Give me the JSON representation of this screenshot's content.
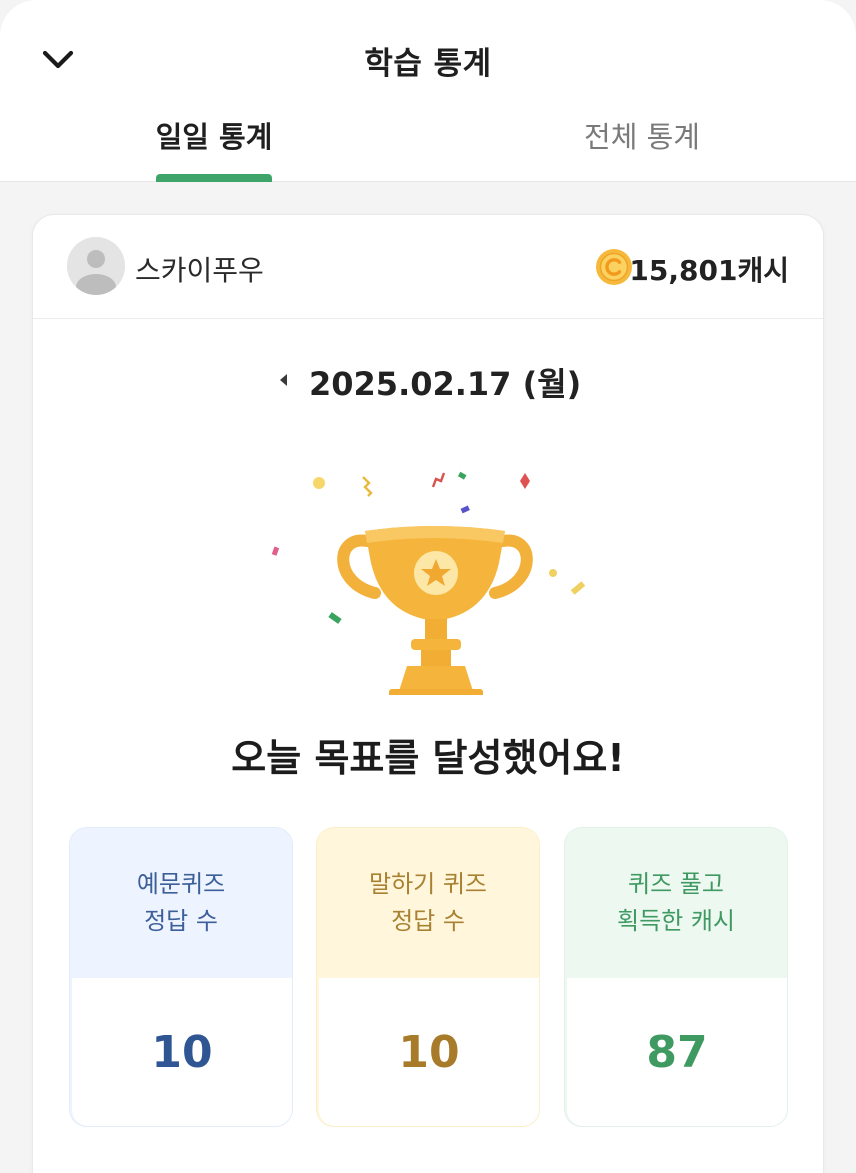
{
  "header": {
    "title": "학습 통계",
    "tabs": [
      {
        "label": "일일 통계",
        "active": true
      },
      {
        "label": "전체 통계",
        "active": false
      }
    ],
    "accent_color": "#3fa46a"
  },
  "profile": {
    "username": "스카이푸우",
    "cash": "15,801캐시"
  },
  "date": {
    "label": "2025.02.17 (월)"
  },
  "message": "오늘 목표를 달성했어요!",
  "stats": [
    {
      "line1": "예문퀴즈",
      "line2": "정답 수",
      "value": "10",
      "color": "#2f5593"
    },
    {
      "line1": "말하기 퀴즈",
      "line2": "정답 수",
      "value": "10",
      "color": "#a77b2a"
    },
    {
      "line1": "퀴즈 풀고",
      "line2": "획득한 캐시",
      "value": "87",
      "color": "#3f9a62"
    }
  ]
}
